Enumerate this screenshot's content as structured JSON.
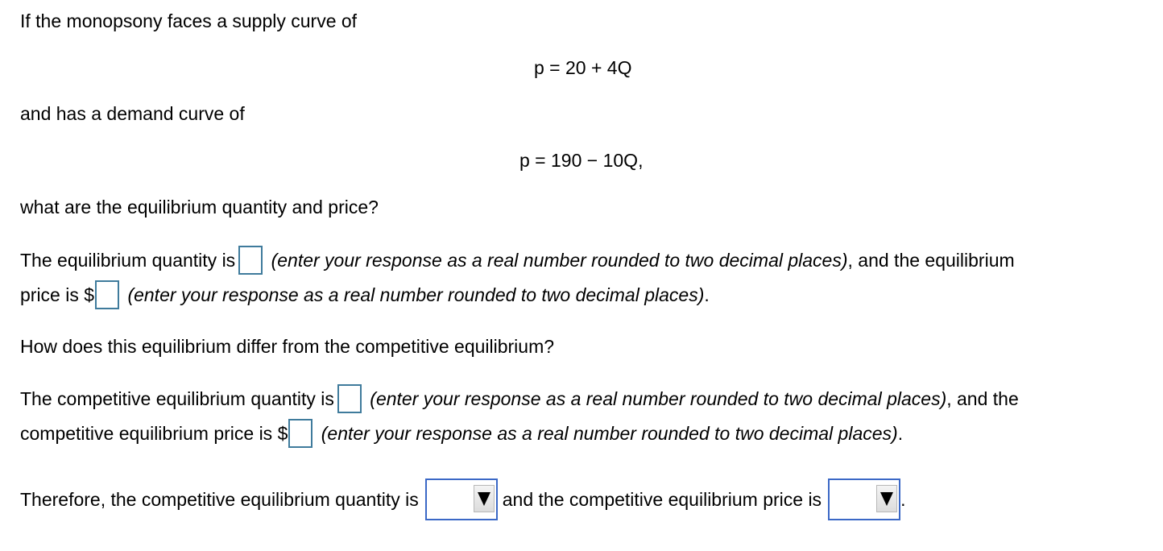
{
  "question": {
    "intro_supply": "If the monopsony faces a supply curve of",
    "supply_equation": "p = 20 + 4Q",
    "intro_demand": "and has a demand curve of",
    "demand_equation": "p = 190 − 10Q,",
    "prompt": "what are the equilibrium quantity and price?"
  },
  "part1": {
    "quantity_prefix": "The equilibrium quantity is",
    "quantity_value": "",
    "quantity_hint": "(enter your response as a real number rounded to two decimal places)",
    "quantity_suffix": ", and the equilibrium",
    "price_prefix": "price is $",
    "price_value": "",
    "price_hint": "(enter your response as a real number rounded to two decimal places)",
    "price_suffix": "."
  },
  "comparison_question": "How does this equilibrium differ from the competitive equilibrium?",
  "part2": {
    "quantity_prefix": "The competitive equilibrium quantity is",
    "quantity_value": "",
    "quantity_hint": "(enter your response as a real number rounded to two decimal places)",
    "quantity_suffix": ", and the",
    "price_prefix": "competitive equilibrium price is $",
    "price_value": "",
    "price_hint": "(enter your response as a real number rounded to two decimal places)",
    "price_suffix": "."
  },
  "part3": {
    "prefix": "Therefore, the competitive equilibrium quantity is",
    "quantity_dropdown_selected": "",
    "middle": "and the competitive equilibrium price is",
    "price_dropdown_selected": "",
    "suffix": "."
  },
  "icons": {
    "dropdown_arrow": "down-triangle"
  },
  "colors": {
    "text": "#000000",
    "input_border": "#3f7b9c",
    "dropdown_border": "#3b68c6",
    "background": "#ffffff"
  }
}
